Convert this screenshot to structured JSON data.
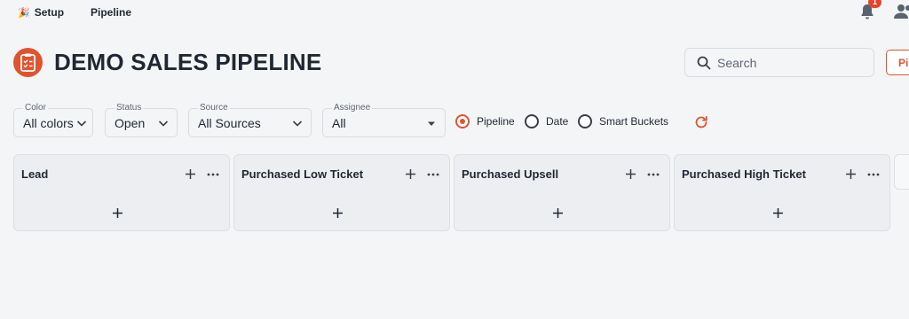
{
  "nav": {
    "setup_label": "Setup",
    "pipeline_label": "Pipeline",
    "notification_count": "1"
  },
  "header": {
    "title": "DEMO SALES PIPELINE",
    "search_placeholder": "Search",
    "pipeline_button_label": "Pip"
  },
  "filters": {
    "color": {
      "label": "Color",
      "value": "All colors"
    },
    "status": {
      "label": "Status",
      "value": "Open"
    },
    "source": {
      "label": "Source",
      "value": "All Sources"
    },
    "assignee": {
      "label": "Assignee",
      "value": "All"
    }
  },
  "view_options": {
    "selected": "Pipeline",
    "items": [
      "Pipeline",
      "Date",
      "Smart Buckets"
    ]
  },
  "columns": [
    {
      "title": "Lead"
    },
    {
      "title": "Purchased Low Ticket"
    },
    {
      "title": "Purchased Upsell"
    },
    {
      "title": "Purchased High Ticket"
    }
  ],
  "colors": {
    "accent": "#e0532f",
    "badge": "#e5432e",
    "text": "#1f2733",
    "background": "#f4f5f7"
  }
}
